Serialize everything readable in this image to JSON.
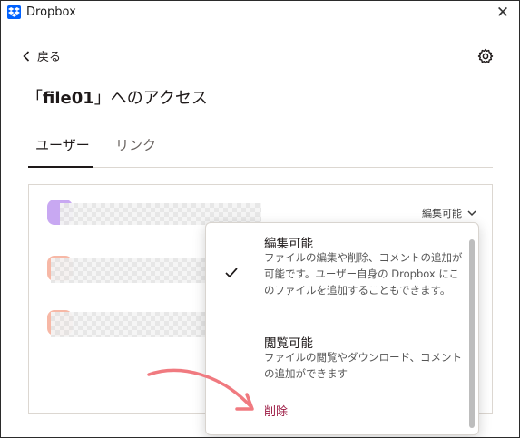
{
  "window": {
    "title": "Dropbox",
    "close_glyph": "✕",
    "app_icon": "dropbox-icon"
  },
  "nav": {
    "back_label": "戻る",
    "back_glyph": "‹"
  },
  "page": {
    "title_prefix": "「",
    "title_file": "file01",
    "title_suffix": "」へのアクセス"
  },
  "tabs": [
    {
      "label": "ユーザー",
      "active": true
    },
    {
      "label": "リンク",
      "active": false
    }
  ],
  "members": {
    "role_label": "編集可能",
    "avatar_colors": [
      "#c8a8f2",
      "#f7b8a6",
      "#f7b8a6"
    ]
  },
  "menu": {
    "options": [
      {
        "title": "編集可能",
        "desc": "ファイルの編集や削除、コメントの追加が可能です。ユーザー自身の Dropbox にこのファイルを追加することもできます。",
        "selected": true
      },
      {
        "title": "閲覧可能",
        "desc": "ファイルの閲覧やダウンロード、コメントの追加ができます",
        "selected": false
      }
    ],
    "delete_label": "削除"
  },
  "colors": {
    "accent": "#0061fe",
    "danger": "#9c1a43",
    "annotation_arrow": "#f07a80"
  }
}
